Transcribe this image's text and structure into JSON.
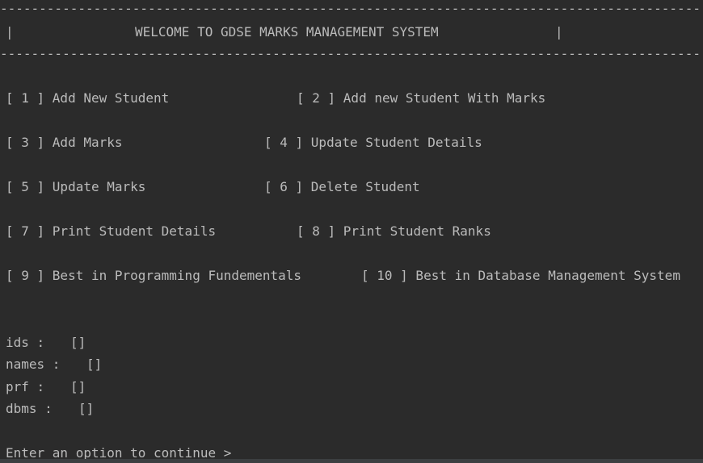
{
  "header": {
    "rule": "------------------------------------------------------------------------------------------",
    "left_border": "|",
    "title": "WELCOME TO GDSE MARKS MANAGEMENT SYSTEM",
    "right_border": "|"
  },
  "menu": {
    "rows": [
      [
        "[ 1 ] Add New Student",
        "[ 2 ] Add new Student With Marks"
      ],
      [
        "[ 3 ] Add Marks",
        "[ 4 ] Update Student Details"
      ],
      [
        "[ 5 ] Update Marks",
        "[ 6 ] Delete Student"
      ],
      [
        "[ 7 ] Print Student Details",
        "[ 8 ] Print Student Ranks"
      ],
      [
        "[ 9 ] Best in Programming Fundementals",
        "[ 10 ] Best in Database Management System"
      ]
    ]
  },
  "arrays": [
    {
      "label": "ids :",
      "value": "[]"
    },
    {
      "label": "names :",
      "value": "[]"
    },
    {
      "label": "prf :",
      "value": "[]"
    },
    {
      "label": "dbms :",
      "value": "[]"
    }
  ],
  "prompt": "Enter an option to continue >",
  "colors": {
    "background": "#2b2b2b",
    "text": "#bbbbbb"
  }
}
